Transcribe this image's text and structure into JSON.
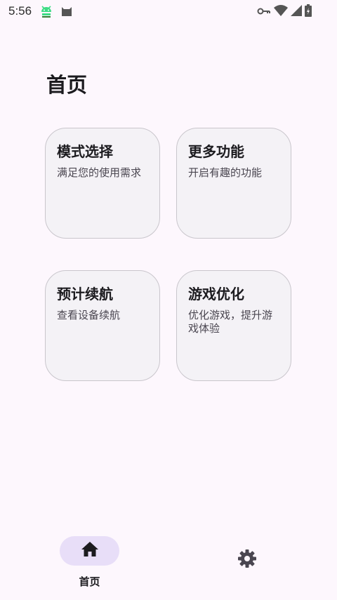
{
  "status_bar": {
    "time": "5:56",
    "app_icons": [
      "android-debug-icon",
      "cat-icon"
    ],
    "system_icons": [
      "key-icon",
      "wifi-icon",
      "signal-icon",
      "battery-charging-icon"
    ]
  },
  "page": {
    "title": "首页"
  },
  "cards": [
    {
      "title": "模式选择",
      "description": "满足您的使用需求"
    },
    {
      "title": "更多功能",
      "description": "开启有趣的功能"
    },
    {
      "title": "预计续航",
      "description": "查看设备续航"
    },
    {
      "title": "游戏优化",
      "description": "优化游戏，提升游戏体验"
    }
  ],
  "bottom_nav": {
    "home_label": "首页",
    "home_icon": "home-icon",
    "settings_icon": "gear-icon"
  }
}
